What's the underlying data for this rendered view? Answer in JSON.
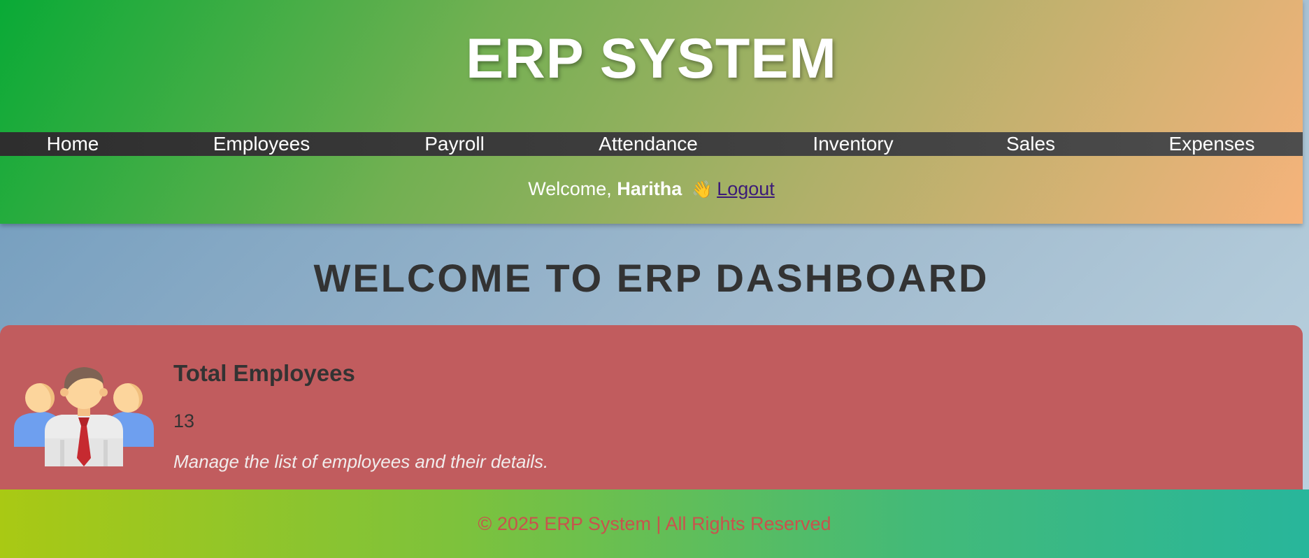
{
  "header": {
    "title": "ERP SYSTEM",
    "nav": [
      {
        "label": "Home"
      },
      {
        "label": "Employees"
      },
      {
        "label": "Payroll"
      },
      {
        "label": "Attendance"
      },
      {
        "label": "Inventory"
      },
      {
        "label": "Sales"
      },
      {
        "label": "Expenses"
      }
    ],
    "welcome_prefix": "Welcome,",
    "username": "Haritha",
    "wave_emoji": "👋",
    "logout_label": "Logout"
  },
  "main": {
    "title": "WELCOME TO ERP DASHBOARD",
    "card": {
      "icon": "team-employees-icon",
      "title": "Total Employees",
      "value": "13",
      "description": "Manage the list of employees and their details."
    }
  },
  "footer": {
    "text": "© 2025 ERP System | All Rights Reserved"
  },
  "colors": {
    "card_bg": "#c15c5e",
    "nav_bg": "#3a3a3a",
    "footer_text": "#c8534d"
  }
}
